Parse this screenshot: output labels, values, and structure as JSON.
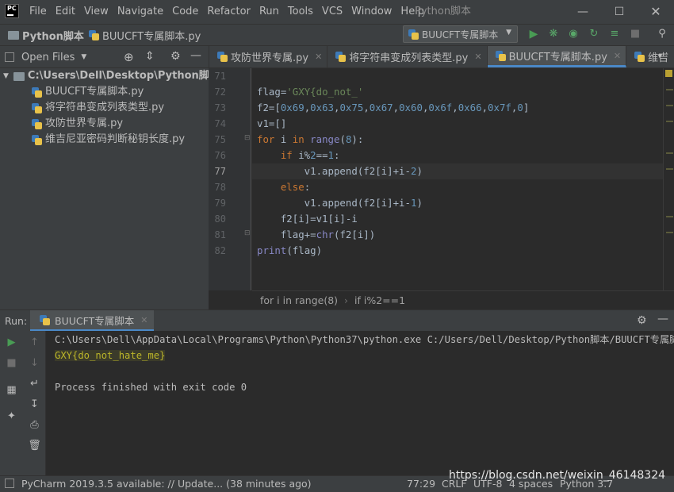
{
  "window": {
    "logo_text": "PC",
    "title": "Python脚本",
    "menu": [
      "File",
      "Edit",
      "View",
      "Navigate",
      "Code",
      "Refactor",
      "Run",
      "Tools",
      "VCS",
      "Window",
      "Help"
    ]
  },
  "navbar": {
    "project": "Python脚本",
    "file": "BUUCFT专属脚本.py",
    "run_config": "BUUCFT专属脚本"
  },
  "project_panel": {
    "header": "Open Files",
    "root": "C:\\Users\\Dell\\Desktop\\Python脚本",
    "files": [
      "BUUCFT专属脚本.py",
      "将字符串变成列表类型.py",
      "攻防世界专属.py",
      "维吉尼亚密码判断秘钥长度.py"
    ]
  },
  "tabs": [
    {
      "label": "攻防世界专属.py",
      "active": false
    },
    {
      "label": "将字符串变成列表类型.py",
      "active": false
    },
    {
      "label": "BUUCFT专属脚本.py",
      "active": true
    },
    {
      "label": "维吉",
      "active": false
    }
  ],
  "editor": {
    "line_numbers": [
      "71",
      "72",
      "73",
      "74",
      "75",
      "76",
      "77",
      "78",
      "79",
      "80",
      "81",
      "82"
    ],
    "current_line": 6,
    "breadcrumbs": [
      "for i in range(8)",
      "if i%2==1"
    ]
  },
  "run": {
    "label": "Run:",
    "tab": "BUUCFT专属脚本",
    "command": "C:\\Users\\Dell\\AppData\\Local\\Programs\\Python\\Python37\\python.exe C:/Users/Dell/Desktop/Python脚本/BUUCFT专属脚本.py",
    "output": "GXY{do_not_hate_me}",
    "finished": "Process finished with exit code 0"
  },
  "status": {
    "update": "PyCharm 2019.3.5 available: // Update... (38 minutes ago)",
    "position": "77:29",
    "line_sep": "CRLF",
    "encoding": "UTF-8",
    "indent": "4 spaces",
    "interpreter": "Python 3.7",
    "watermark": "https://blog.csdn.net/weixin_46148324"
  },
  "colors": {
    "accent": "#4a88c7",
    "keyword": "#cc7832",
    "number": "#6897bb",
    "string": "#6a8759",
    "run_green": "#499c54",
    "debug_green": "#59a869"
  }
}
